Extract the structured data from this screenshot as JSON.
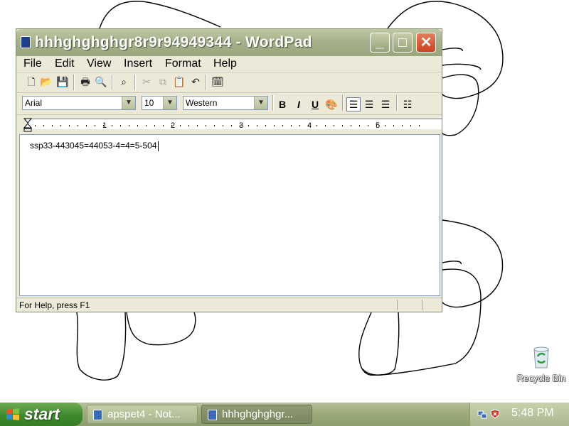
{
  "window": {
    "title": "hhhghghghgr8r9r94949344 - WordPad",
    "controls": {
      "minimize": "_",
      "maximize": "□",
      "close": "✕"
    }
  },
  "menubar": {
    "items": [
      {
        "label": "File"
      },
      {
        "label": "Edit"
      },
      {
        "label": "View"
      },
      {
        "label": "Insert"
      },
      {
        "label": "Format"
      },
      {
        "label": "Help"
      }
    ]
  },
  "toolbar": {
    "icons": [
      "new-icon",
      "open-icon",
      "save-icon",
      "print-icon",
      "print-preview-icon",
      "find-icon",
      "cut-icon",
      "copy-icon",
      "paste-icon",
      "undo-icon",
      "insert-date-time-icon"
    ]
  },
  "format_bar": {
    "font": "Arial",
    "size": "10",
    "script": "Western",
    "bold": "B",
    "italic": "I",
    "underline": "U",
    "alignment": "left"
  },
  "ruler": {
    "numbers": [
      "1",
      "2",
      "3",
      "4",
      "5"
    ]
  },
  "document": {
    "text": "ssp33-443045=44053-4=4=5-504"
  },
  "status": {
    "text": "For Help, press F1"
  },
  "desktop": {
    "recycle_bin": "Recycle Bin"
  },
  "taskbar": {
    "start_label": "start",
    "tasks": [
      {
        "label": "apspet4 - Not..."
      },
      {
        "label": "hhhghghghgr..."
      }
    ],
    "clock": "5:48 PM"
  },
  "colors": {
    "titlebar": "#a7b189",
    "start_button": "#3f8a2d",
    "close_button": "#c94420"
  }
}
